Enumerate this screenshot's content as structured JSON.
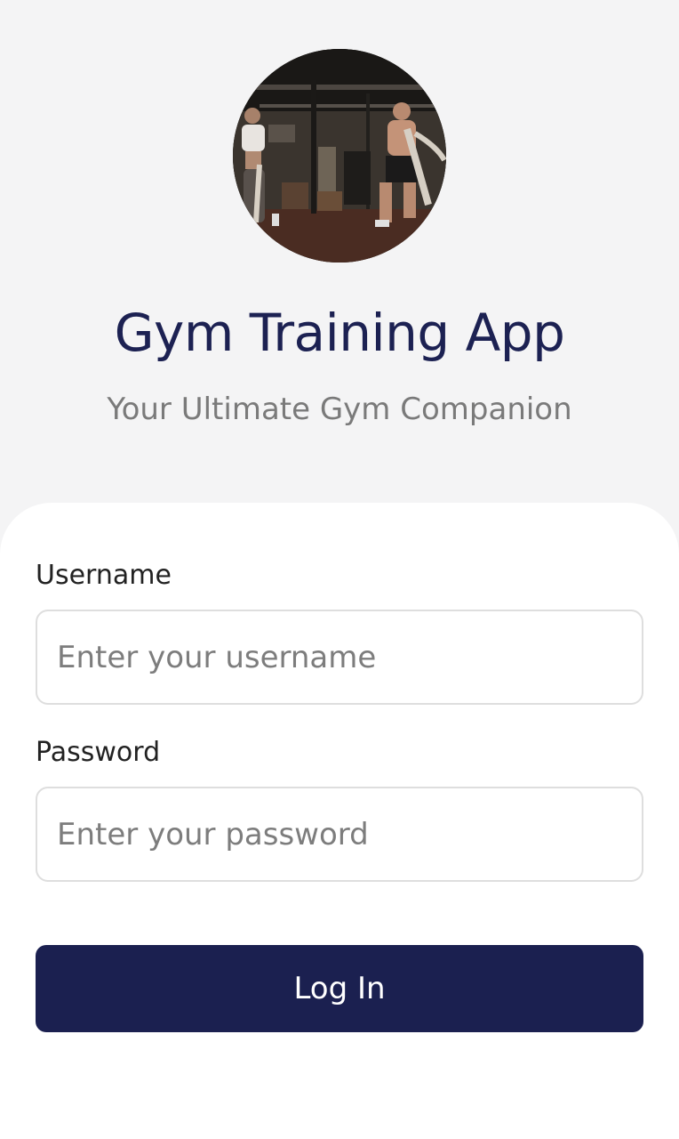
{
  "header": {
    "avatar_alt": "gym-training-photo",
    "title": "Gym Training App",
    "subtitle": "Your Ultimate Gym Companion"
  },
  "form": {
    "username": {
      "label": "Username",
      "placeholder": "Enter your username",
      "value": ""
    },
    "password": {
      "label": "Password",
      "placeholder": "Enter your password",
      "value": ""
    },
    "submit_label": "Log In"
  },
  "colors": {
    "background": "#f4f4f5",
    "card": "#ffffff",
    "primary": "#1b2050",
    "title": "#1c2152",
    "subtitle": "#7a7a7a"
  }
}
